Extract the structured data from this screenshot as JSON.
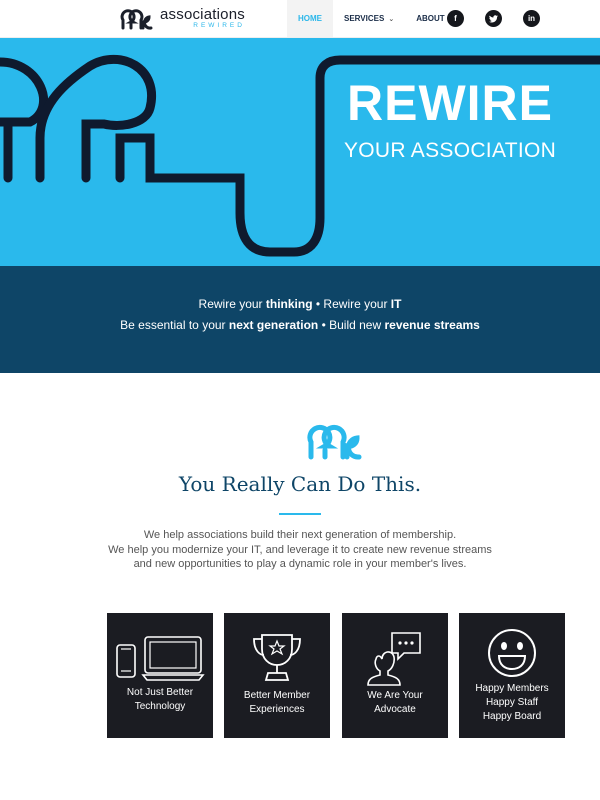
{
  "header": {
    "logo_main": "associations",
    "logo_sub": "REWIRED",
    "nav": [
      {
        "label": "HOME",
        "active": true
      },
      {
        "label": "SERVICES",
        "has_caret": true
      },
      {
        "label": "ABOUT"
      }
    ],
    "social": [
      {
        "icon": "facebook-icon",
        "glyph": "f"
      },
      {
        "icon": "twitter-icon",
        "glyph": "t"
      },
      {
        "icon": "linkedin-icon",
        "glyph": "in"
      }
    ]
  },
  "hero": {
    "title": "REWIRE",
    "subtitle": "YOUR ASSOCIATION",
    "bg_color": "#2ab9ec"
  },
  "band": {
    "line1": {
      "a": "Rewire your ",
      "b": "thinking",
      "c": " • Rewire your ",
      "d": "IT"
    },
    "line2": {
      "a": "Be essential to your ",
      "b": "next generation",
      "c": " • Build new ",
      "d": "revenue streams"
    },
    "bg_color": "#0e4567"
  },
  "intro": {
    "title": "You Really Can Do This.",
    "text_lines": [
      "We help associations build their next generation of membership.",
      "We help you modernize your IT, and leverage it to create new revenue streams",
      "and new opportunities to play a dynamic role in your member's lives."
    ]
  },
  "cards": [
    {
      "icon": "devices-icon",
      "lines": [
        "Not Just Better",
        "Technology"
      ]
    },
    {
      "icon": "trophy-icon",
      "lines": [
        "Better Member",
        "Experiences"
      ]
    },
    {
      "icon": "speaker-icon",
      "lines": [
        "We Are Your",
        "Advocate"
      ]
    },
    {
      "icon": "smiley-icon",
      "lines": [
        "Happy Members",
        "Happy Staff",
        "Happy Board"
      ]
    }
  ]
}
